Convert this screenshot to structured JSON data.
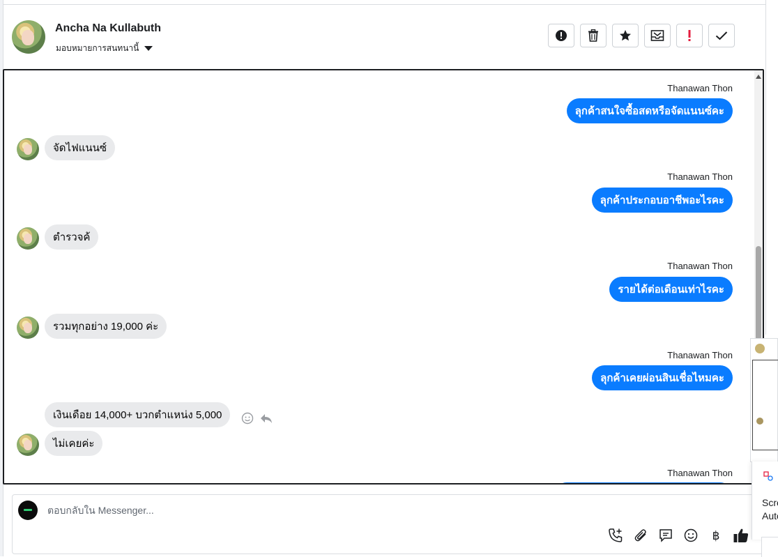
{
  "header": {
    "contact_name": "Ancha Na Kullabuth",
    "assign_label": "มอบหมายการสนทนานี้",
    "tools": [
      {
        "name": "spam-report-button",
        "icon": "alert-circle-icon"
      },
      {
        "name": "delete-button",
        "icon": "trash-icon"
      },
      {
        "name": "star-button",
        "icon": "star-icon"
      },
      {
        "name": "mark-unread-button",
        "icon": "envelope-icon"
      },
      {
        "name": "follow-up-button",
        "icon": "exclamation-icon"
      },
      {
        "name": "done-button",
        "icon": "check-icon"
      }
    ]
  },
  "conversation": {
    "messages": [
      {
        "direction": "out",
        "sender": "Thanawan Thon",
        "text": "ลุกค้าสนใจซื้อสดหรือจัดแนนซ์คะ"
      },
      {
        "direction": "in",
        "text": "จัดไฟแนนซ์"
      },
      {
        "direction": "out",
        "sender": "Thanawan Thon",
        "text": "ลุกค้าประกอบอาชีพอะไรคะ"
      },
      {
        "direction": "in",
        "text": "ตำรวจค้"
      },
      {
        "direction": "out",
        "sender": "Thanawan Thon",
        "text": "รายได้ต่อเดือนเท่าไรคะ"
      },
      {
        "direction": "in",
        "text": "รวมทุกอย่าง 19,000 ค่ะ"
      },
      {
        "direction": "out",
        "sender": "Thanawan Thon",
        "text": "ลุกค้าเคยผ่อนสินเชื่อไหมคะ"
      },
      {
        "direction": "in",
        "text": "เงินเดือย 14,000+ บวกตำแหน่ง 5,000"
      },
      {
        "direction": "in",
        "text": "ไม่เคยค่ะ"
      },
      {
        "direction": "out",
        "sender": "Thanawan Thon",
        "text": ""
      }
    ]
  },
  "composer": {
    "placeholder": "ตอบกลับใน Messenger...",
    "tools": [
      "phone-plus-icon",
      "paperclip-icon",
      "saved-reply-icon",
      "emoji-icon",
      "baht-icon",
      "thumbs-up-icon"
    ]
  },
  "side_popup": {
    "line1": "Scre",
    "line2": "Auto"
  },
  "colors": {
    "outgoing_bubble": "#0a7cff",
    "incoming_bubble": "#e9eaec",
    "thumbs_up": "#1c1e21"
  }
}
